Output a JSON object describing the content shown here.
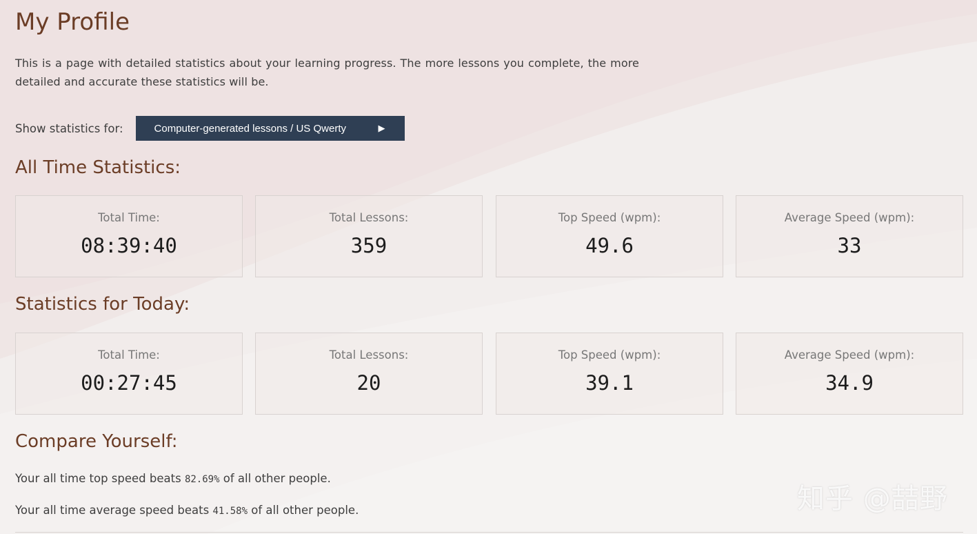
{
  "page": {
    "title": "My Profile",
    "intro": "This is a page with detailed statistics about your learning progress. The more lessons you complete, the more detailed and accurate these statistics will be."
  },
  "source_selector": {
    "label": "Show statistics for:",
    "button_label": "Computer-generated lessons / US Qwerty",
    "button_icon": "▶"
  },
  "all_time": {
    "title": "All Time Statistics:",
    "cards": [
      {
        "label": "Total Time:",
        "value": "08:39:40"
      },
      {
        "label": "Total Lessons:",
        "value": "359"
      },
      {
        "label": "Top Speed (wpm):",
        "value": "49.6"
      },
      {
        "label": "Average Speed (wpm):",
        "value": "33"
      }
    ]
  },
  "today": {
    "title": "Statistics for Today:",
    "cards": [
      {
        "label": "Total Time:",
        "value": "00:27:45"
      },
      {
        "label": "Total Lessons:",
        "value": "20"
      },
      {
        "label": "Top Speed (wpm):",
        "value": "39.1"
      },
      {
        "label": "Average Speed (wpm):",
        "value": "34.9"
      }
    ]
  },
  "compare": {
    "title": "Compare Yourself:",
    "top_speed": {
      "prefix": "Your all time top speed beats ",
      "value": "82.69%",
      "suffix": " of all other people."
    },
    "average_speed": {
      "prefix": "Your all time average speed beats ",
      "value": "41.58%",
      "suffix": " of all other people."
    }
  },
  "watermark": "知乎 @喆野",
  "colors": {
    "heading": "#6b3d26",
    "button_bg": "#2f3f54",
    "background": "#f2eeed"
  }
}
